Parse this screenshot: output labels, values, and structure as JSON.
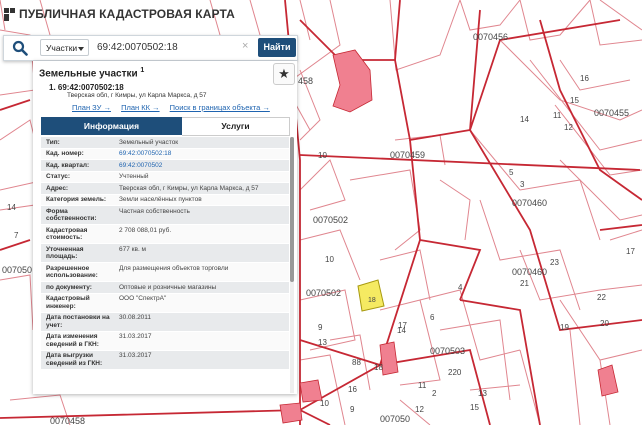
{
  "app": {
    "title": "ПУБЛИЧНАЯ КАДАСТРОВАЯ КАРТА"
  },
  "search": {
    "type_label": "Участки",
    "value": "69:42:0070502:18",
    "button_label": "Найти",
    "clear_symbol": "×"
  },
  "panel": {
    "title": "Земельные участки",
    "count": "1",
    "favorite_symbol": "★",
    "item": {
      "index": "1.",
      "number": "69:42:0070502:18",
      "address": "Тверская обл, г Кимры, ул Карла Маркса, д 57"
    },
    "links": [
      "План ЗУ →",
      "План КК →",
      "Поиск в границах объекта →"
    ],
    "tabs": {
      "info": "Информация",
      "services": "Услуги"
    },
    "rows": [
      {
        "k": "Тип:",
        "v": "Земельный участок"
      },
      {
        "k": "Кад. номер:",
        "v": "69:42:0070502:18"
      },
      {
        "k": "Кад. квартал:",
        "v": "69:42:0070502"
      },
      {
        "k": "Статус:",
        "v": "Учтенный"
      },
      {
        "k": "Адрес:",
        "v": "Тверская обл, г Кимры, ул Карла Маркса, д 57"
      },
      {
        "k": "Категория земель:",
        "v": "Земли населённых пунктов"
      },
      {
        "k": "Форма собственности:",
        "v": "Частная собственность"
      },
      {
        "k": "Кадастровая стоимость:",
        "v": "2 708 088,01 руб."
      },
      {
        "k": "Уточненная площадь:",
        "v": "677 кв. м"
      },
      {
        "k": "Разрешенное использование:",
        "v": "Для размещения объектов торговли"
      },
      {
        "k": "по документу:",
        "v": "Оптовые и розничные магазины"
      },
      {
        "k": "Кадастровый инженер:",
        "v": "ООО \"СпектрА\""
      },
      {
        "k": "Дата постановки на учет:",
        "v": "30.08.2011"
      },
      {
        "k": "Дата изменения сведений в ГКН:",
        "v": "31.03.2017"
      },
      {
        "k": "Дата выгрузки сведений из ГКН:",
        "v": "31.03.2017"
      }
    ]
  },
  "map": {
    "labels": [
      "0070456",
      "0070455",
      "0070459",
      "0070460",
      "0070460",
      "0070502",
      "0070502",
      "0070503",
      "007050",
      "0070458",
      "007050",
      "458",
      "11",
      "12",
      "16",
      "15",
      "14",
      "7",
      "5",
      "3",
      "17",
      "10",
      "21",
      "18",
      "4",
      "6",
      "14",
      "23",
      "22",
      "20",
      "19",
      "10",
      "9",
      "13",
      "88",
      "220",
      "16",
      "17",
      "18",
      "13",
      "15",
      "11",
      "12",
      "2",
      "9",
      "10",
      "14"
    ]
  }
}
